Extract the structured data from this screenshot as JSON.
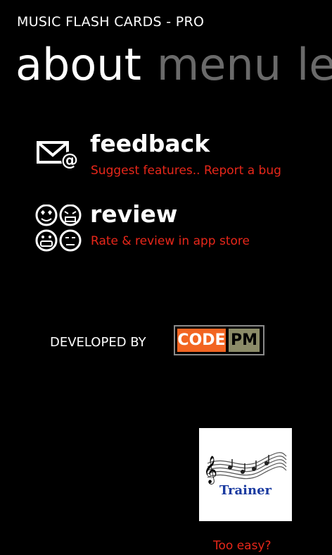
{
  "app": {
    "title": "MUSIC FLASH CARDS - PRO"
  },
  "pivot": {
    "items": [
      "about",
      "menu",
      "le"
    ]
  },
  "actions": [
    {
      "title": "feedback",
      "subtitle": "Suggest features.. Report a bug",
      "icon": "mail-at-icon"
    },
    {
      "title": "review",
      "subtitle": "Rate & review in app store",
      "icon": "emoji-faces-icon"
    }
  ],
  "developer": {
    "label": "DEVELOPED BY",
    "logo_left": "CODE",
    "logo_right": "PM"
  },
  "promo": {
    "logo_text": "Trainer",
    "caption": "Too easy?"
  },
  "colors": {
    "accent": "#e8271a",
    "inactive_pivot": "#6a6a6a",
    "logo_code_bg": "#f26522",
    "logo_pm_bg": "#8b8b68"
  }
}
